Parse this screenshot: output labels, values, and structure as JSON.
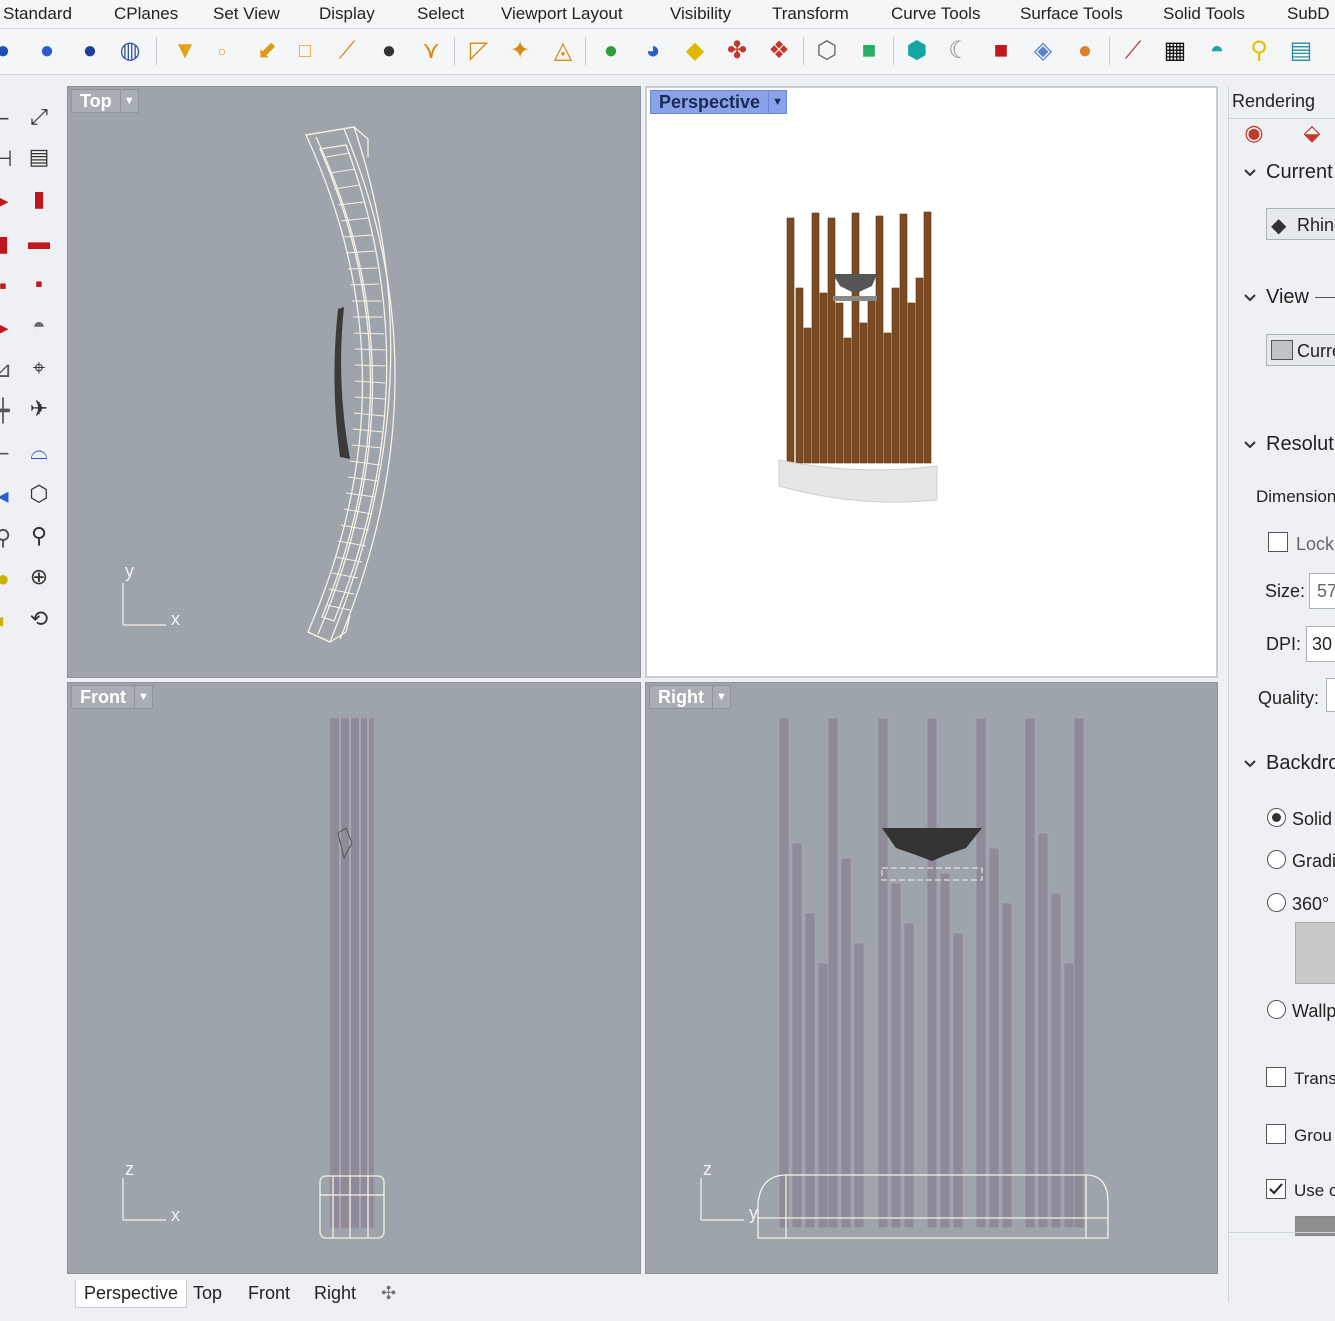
{
  "toolbar_tabs": [
    "Standard",
    "CPlanes",
    "Set View",
    "Display",
    "Select",
    "Viewport Layout",
    "Visibility",
    "Transform",
    "Curve Tools",
    "Surface Tools",
    "Solid Tools",
    "SubD"
  ],
  "viewports": {
    "top": {
      "label": "Top",
      "axis_x": "x",
      "axis_y": "y"
    },
    "perspective": {
      "label": "Perspective"
    },
    "front": {
      "label": "Front",
      "axis_x": "x",
      "axis_y": "z"
    },
    "right": {
      "label": "Right",
      "axis_x": "y",
      "axis_y": "z"
    }
  },
  "viewport_tabs": [
    "Perspective",
    "Top",
    "Front",
    "Right"
  ],
  "active_viewport_tab": "Perspective",
  "panel": {
    "title": "Rendering",
    "current_section": "Current",
    "current_renderer": "Rhino",
    "view_section": "View",
    "view_value": "Curre",
    "resolution_section": "Resoluti",
    "dimensions_label": "Dimension",
    "lock_label": "Lock",
    "size_label": "Size:",
    "size_value": "57",
    "dpi_label": "DPI:",
    "dpi_value": "30",
    "quality_label": "Quality:",
    "backdrop_section": "Backdro",
    "radio_solid": "Solid",
    "radio_gradient": "Gradi",
    "radio_360": "360°",
    "radio_wallpaper": "Wallp",
    "check_transparent": "Transp",
    "check_ground": "Grou",
    "check_use": "Use c"
  },
  "colors": {
    "viewport_bg": "#9ea4ac",
    "active_label_bg": "#8aa2e8",
    "wood": "#7a4a22",
    "base": "#e6e6e6",
    "wire": "#f4f1e6"
  }
}
